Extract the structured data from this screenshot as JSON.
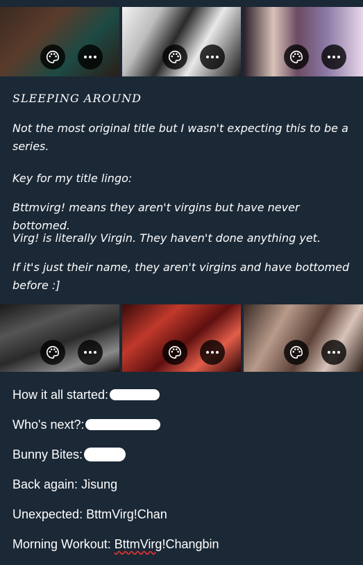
{
  "heading": "SLEEPING AROUND",
  "paragraphs": {
    "p1": "Not the most original title but I wasn't expecting this to be a series.",
    "p2": "Key for my title lingo:",
    "p3": "Bttmvirg! means they aren't virgins but have never bottomed.",
    "p4": "Virg! is literally Virgin. They haven't done anything yet.",
    "p5": "If it's just their name, they aren't virgins and have bottomed before :]"
  },
  "list": [
    {
      "label": "How it all started:",
      "value": ""
    },
    {
      "label": "Who's next?:",
      "value": ""
    },
    {
      "label": "Bunny Bites:",
      "value": ""
    },
    {
      "label": "Back again:",
      "value": "Jisung"
    },
    {
      "label": "Unexpected:",
      "value": "BttmVirg!Chan"
    },
    {
      "label": "Morning Workout:",
      "value_a": "BttmVirg",
      "value_b": "!Changbin"
    }
  ],
  "icons": {
    "palette": "palette-icon",
    "more": "more-options-icon"
  }
}
